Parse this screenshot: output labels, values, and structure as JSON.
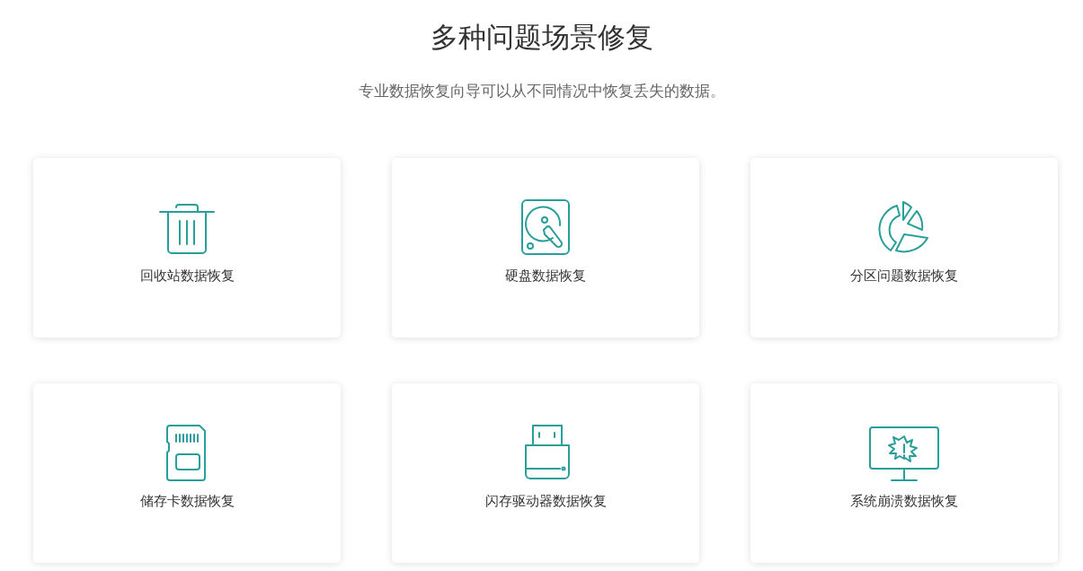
{
  "heading": "多种问题场景修复",
  "subtitle": "专业数据恢复向导可以从不同情况中恢复丢失的数据。",
  "cards": [
    {
      "kind": "trash",
      "label": "回收站数据恢复"
    },
    {
      "kind": "disk",
      "label": "硬盘数据恢复"
    },
    {
      "kind": "partition",
      "label": "分区问题数据恢复"
    },
    {
      "kind": "sdcard",
      "label": "储存卡数据恢复"
    },
    {
      "kind": "usb",
      "label": "闪存驱动器数据恢复"
    },
    {
      "kind": "monitor",
      "label": "系统崩溃数据恢复"
    }
  ]
}
